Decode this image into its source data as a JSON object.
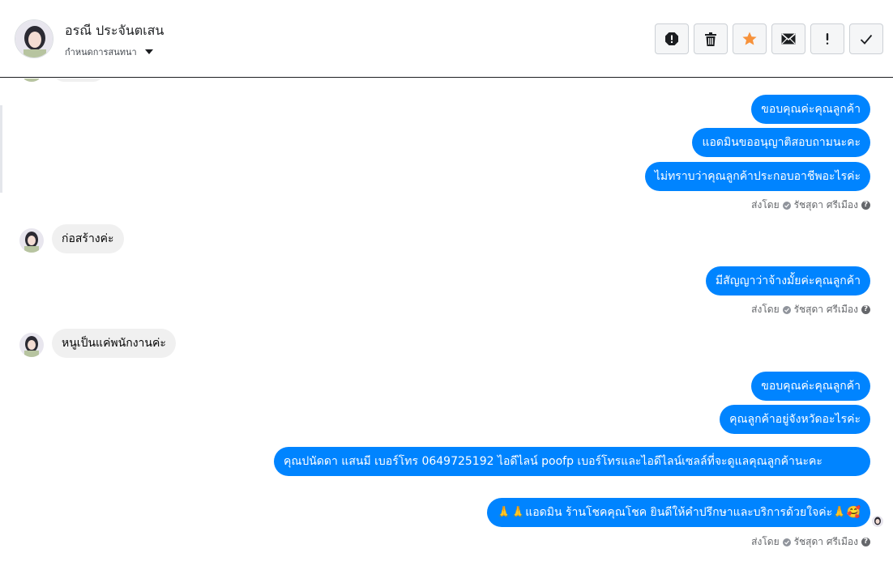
{
  "header": {
    "name": "อรณี ประจันตเสน",
    "subtitle": "กำหนดการสนทนา"
  },
  "toolbar": {
    "buttons": [
      {
        "icon": "spam-alert-icon"
      },
      {
        "icon": "trash-icon"
      },
      {
        "icon": "star-icon",
        "color": "#f7923b"
      },
      {
        "icon": "envelope-icon"
      },
      {
        "icon": "exclamation-icon"
      },
      {
        "icon": "checkmark-icon"
      }
    ]
  },
  "colors": {
    "accent": "#0084ff",
    "incoming": "#f0f0f0",
    "star": "#f7923b"
  },
  "messages": {
    "out1": "ขอบคุณค่ะคุณลูกค้า",
    "out2": "แอดมินขออนุญาติสอบถามนะคะ",
    "out3": "ไม่ทราบว่าคุณลูกค้าประกอบอาชีพอะไรค่ะ",
    "in1": "ก่อสร้างค่ะ",
    "out4": "มีสัญญาว่าจ้างมั้ยค่ะคุณลูกค้า",
    "in2": "หนูเป็นแค่พนักงานค่ะ",
    "out5": "ขอบคุณค่ะคุณลูกค้า",
    "out6": "คุณลูกค้าอยู่จังหวัดอะไรค่ะ",
    "out7": "คุณปนัดดา แสนมี   เบอร์โทร 0649725192  ไอดีไลน์ poofp   เบอร์โทรและไอดีไลน์เซลล์ที่จะดูแลคุณลูกค้านะคะ",
    "out8": "🙏🙏แอดมิน ร้านโชคคุณโชค ยินดีให้คำปรึกษาและบริการด้วยใจค่ะ🙏🥰"
  },
  "sent_by": {
    "label": "ส่งโดย",
    "agent": "รัชสุดา ศรีเมือง"
  }
}
